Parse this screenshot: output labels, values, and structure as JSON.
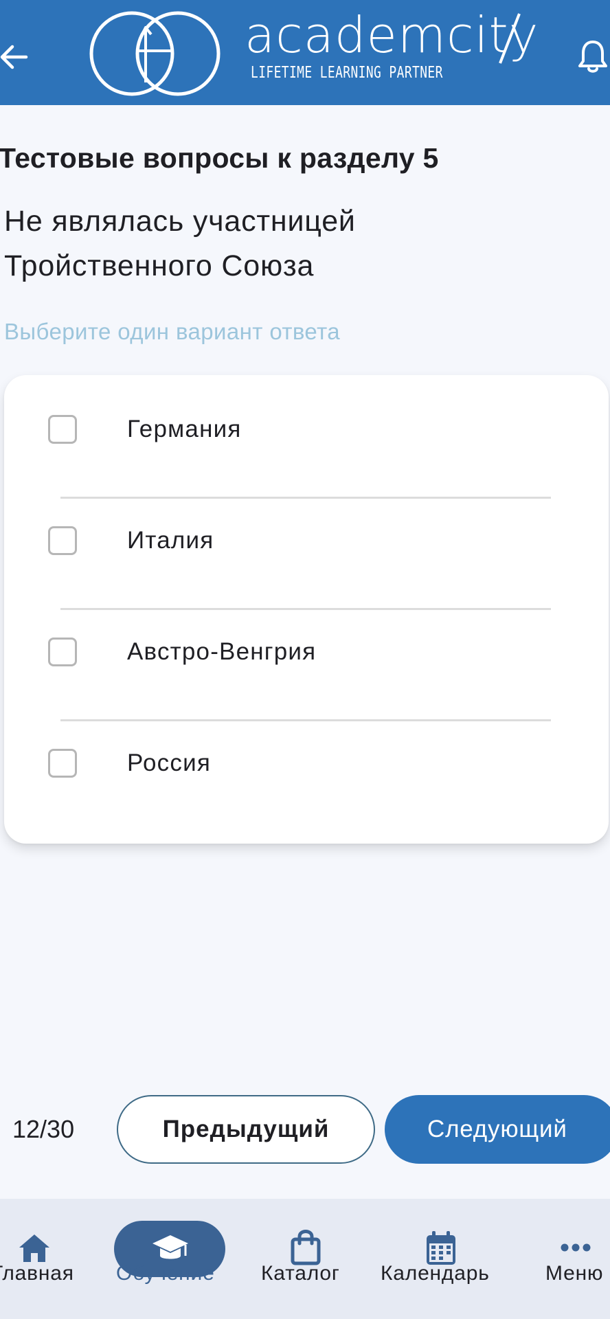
{
  "header": {
    "brand_name": "academcity",
    "tagline": "LIFETIME LEARNING PARTNER",
    "icons": {
      "back": "arrow-left-icon",
      "logo": "logo-icon",
      "notifications": "bell-icon"
    }
  },
  "quiz": {
    "section_title": "Тестовые вопросы к разделу 5",
    "question": "Не являлась участницей Тройственного Союза",
    "hint": "Выберите один вариант ответа",
    "options": [
      {
        "label": "Германия",
        "checked": false
      },
      {
        "label": "Италия",
        "checked": false
      },
      {
        "label": "Австро-Венгрия",
        "checked": false
      },
      {
        "label": "Россия",
        "checked": false
      }
    ]
  },
  "pager": {
    "counter": "12/30",
    "prev_label": "Предыдущий",
    "next_label": "Следующий"
  },
  "bottom_nav": {
    "items": [
      {
        "label": "Главная",
        "icon": "home-icon",
        "active": false
      },
      {
        "label": "Обучение",
        "icon": "graduation-cap-icon",
        "active": true
      },
      {
        "label": "Каталог",
        "icon": "shopping-bag-icon",
        "active": false
      },
      {
        "label": "Календарь",
        "icon": "calendar-icon",
        "active": false
      },
      {
        "label": "Меню",
        "icon": "more-dots-icon",
        "active": false
      }
    ]
  },
  "colors": {
    "brand_blue": "#2d73b9",
    "active_nav": "#3b6394",
    "hint_text": "#9cc5dc",
    "background": "#f5f7fc"
  }
}
